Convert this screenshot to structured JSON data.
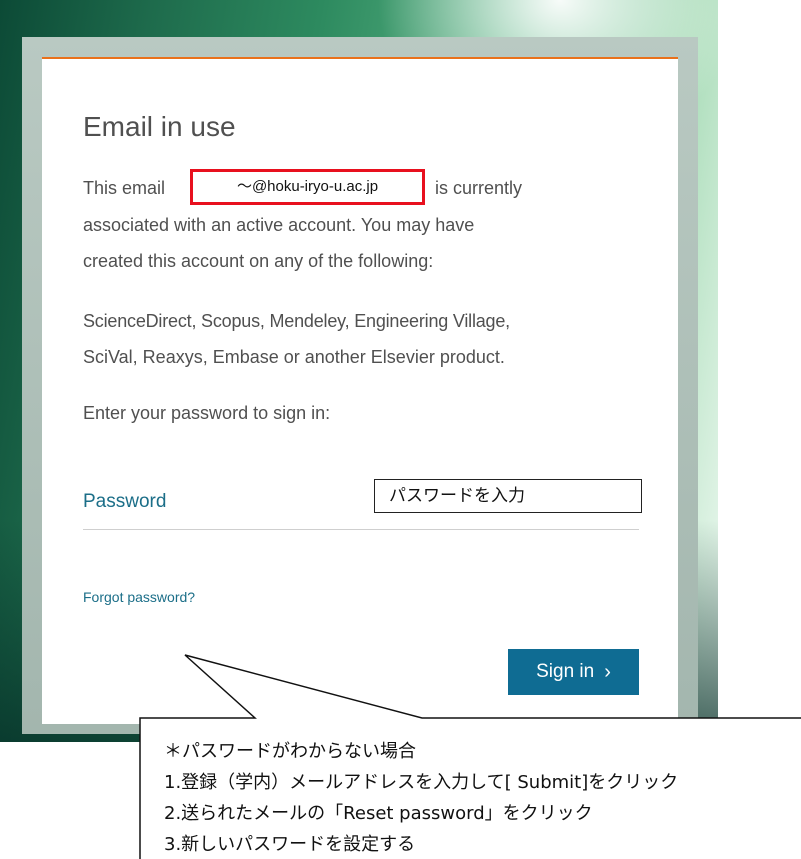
{
  "dialog": {
    "title": "Email in use",
    "email_intro": "This email",
    "email_value": "～@hoku-iryo-u.ac.jp",
    "email_suffix": "is currently",
    "body_line2": "associated with an active account. You may have",
    "body_line3": "created this account on any of the following:",
    "products_line1": "ScienceDirect, Scopus, Mendeley, Engineering Village,",
    "products_line2": "SciVal, Reaxys, Embase or another Elsevier product.",
    "prompt": "Enter your password to sign in:",
    "password_label": "Password",
    "password_placeholder": "パスワードを入力",
    "forgot_link": "Forgot password?",
    "signin_label": "Sign in",
    "signin_icon": "chevron-right-icon"
  },
  "callout": {
    "lines": [
      "＊パスワードがわからない場合",
      "1.登録（学内）メールアドレスを入力して[ Submit]をクリック",
      "2.送られたメールの「Reset password」をクリック",
      "3.新しいパスワードを設定する"
    ]
  },
  "colors": {
    "accent_link": "#1b6e88",
    "button": "#0f6c93",
    "highlight_border": "#e8101e",
    "top_rule": "#e9711c"
  }
}
